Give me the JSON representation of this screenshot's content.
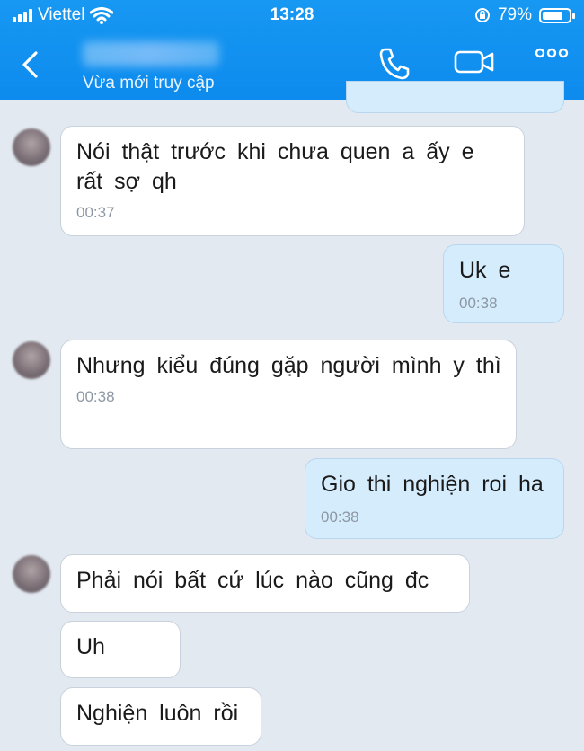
{
  "status_bar": {
    "carrier": "Viettel",
    "time": "13:28",
    "battery_percent": "79%",
    "battery_level": 0.79
  },
  "header": {
    "subtitle": "Vừa mới truy cập",
    "icons": [
      "back-icon",
      "phone-icon",
      "video-call-icon",
      "more-icon"
    ]
  },
  "messages": [
    {
      "side": "received",
      "text": "Nói thật trước khi chưa quen a ấy e rất sợ qh",
      "time": "00:37"
    },
    {
      "side": "sent",
      "text": "Uk e",
      "time": "00:38"
    },
    {
      "side": "received",
      "text": "Nhưng kiểu đúng gặp người mình y thì",
      "time": "00:38"
    },
    {
      "side": "sent",
      "text": "Gio thi nghiện roi ha",
      "time": "00:38"
    },
    {
      "side": "received",
      "text": "Phải nói bất cứ lúc nào cũng đc"
    },
    {
      "side": "received",
      "text": "Uh"
    },
    {
      "side": "received",
      "text": "Nghiện luôn rồi"
    }
  ],
  "colors": {
    "header": "#0d8bee",
    "background": "#e2e9f1",
    "sent_bubble": "#d5ecfd",
    "received_bubble": "#ffffff"
  }
}
